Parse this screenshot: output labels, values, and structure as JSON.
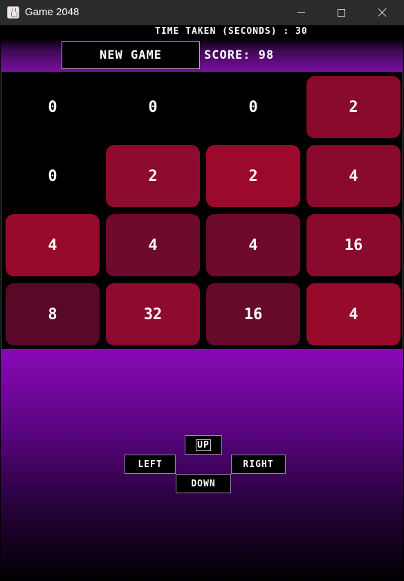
{
  "window": {
    "title": "Game 2048",
    "icon": "java-cup-icon",
    "controls": [
      "minimize-icon",
      "maximize-icon",
      "close-icon"
    ]
  },
  "header": {
    "timer_text": "TIME TAKEN (SECONDS) : 30",
    "new_game_label": "NEW GAME",
    "score_text": "SCORE:  98"
  },
  "board": {
    "rows": [
      [
        "0",
        "0",
        "0",
        "2"
      ],
      [
        "0",
        "2",
        "2",
        "4"
      ],
      [
        "4",
        "4",
        "4",
        "16"
      ],
      [
        "8",
        "32",
        "16",
        "4"
      ]
    ],
    "tile_colors": [
      [
        "",
        "",
        "",
        "#8a0a2e"
      ],
      [
        "",
        "#8c0b2e",
        "#9b0a2c",
        "#8a0a2e"
      ],
      [
        "#980a2c",
        "#6e0a2c",
        "#6e0a2c",
        "#8a0a2e"
      ],
      [
        "#5a0828",
        "#8c0b2e",
        "#660a2a",
        "#980a2c"
      ]
    ]
  },
  "controls": {
    "up": "UP",
    "left": "LEFT",
    "right": "RIGHT",
    "down": "DOWN"
  },
  "colors": {
    "accent_purple": "#8a08b8",
    "board_background": "#000000"
  }
}
